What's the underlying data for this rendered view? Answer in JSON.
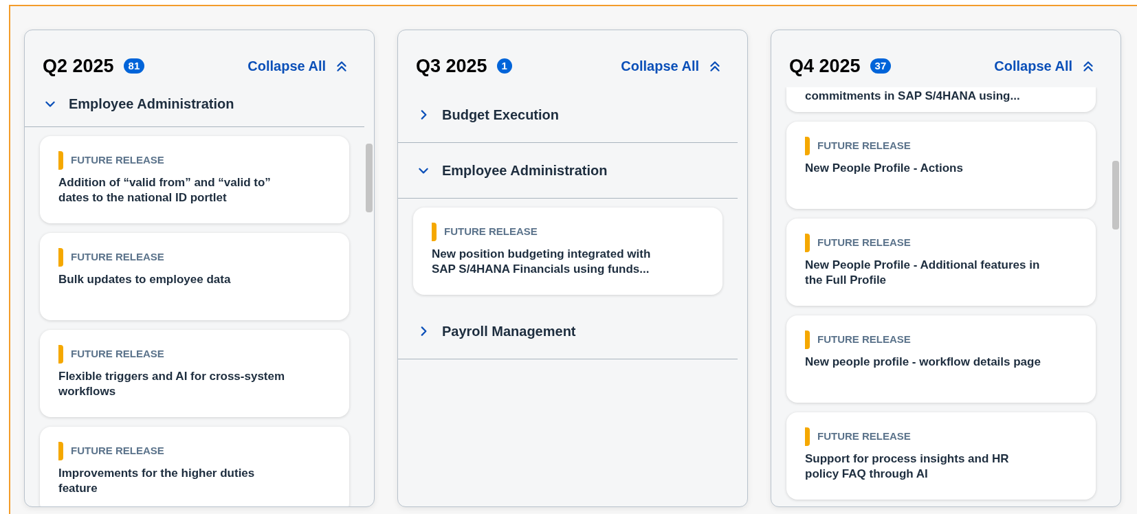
{
  "columns": [
    {
      "title": "Q2 2025",
      "count": "81",
      "collapse_label": "Collapse All",
      "scrollable": true,
      "groups": [
        {
          "name": "Employee Administration",
          "expanded": true,
          "cut_top": true,
          "items": [
            {
              "kind": "card",
              "tag": "FUTURE RELEASE",
              "title": "Addition of “valid from” and “valid to” dates to the national ID portlet"
            },
            {
              "kind": "card",
              "tag": "FUTURE RELEASE",
              "title": "Bulk updates to employee data"
            },
            {
              "kind": "card",
              "tag": "FUTURE RELEASE",
              "title": "Flexible triggers and AI for cross-system workflows"
            },
            {
              "kind": "card",
              "tag": "FUTURE RELEASE",
              "title": "Improvements for the higher duties feature"
            }
          ]
        }
      ]
    },
    {
      "title": "Q3 2025",
      "count": "1",
      "collapse_label": "Collapse All",
      "scrollable": false,
      "groups": [
        {
          "name": "Budget Execution",
          "expanded": false
        },
        {
          "name": "Employee Administration",
          "expanded": true,
          "items": [
            {
              "kind": "card",
              "tag": "FUTURE RELEASE",
              "title": "New position budgeting integrated with SAP S/4HANA Financials using funds..."
            }
          ]
        },
        {
          "name": "Payroll Management",
          "expanded": false
        }
      ]
    },
    {
      "title": "Q4 2025",
      "count": "37",
      "collapse_label": "Collapse All",
      "scrollable": true,
      "items": [
        {
          "kind": "clipped",
          "title": "commitments in SAP S/4HANA using..."
        },
        {
          "kind": "card",
          "tag": "FUTURE RELEASE",
          "title": "New People Profile - Actions"
        },
        {
          "kind": "card",
          "tag": "FUTURE RELEASE",
          "title": "New People Profile - Additional features in the Full Profile"
        },
        {
          "kind": "card",
          "tag": "FUTURE RELEASE",
          "title": "New people profile - workflow details page"
        },
        {
          "kind": "card",
          "tag": "FUTURE RELEASE",
          "title": "Support for process insights and HR policy FAQ through AI"
        }
      ]
    }
  ]
}
